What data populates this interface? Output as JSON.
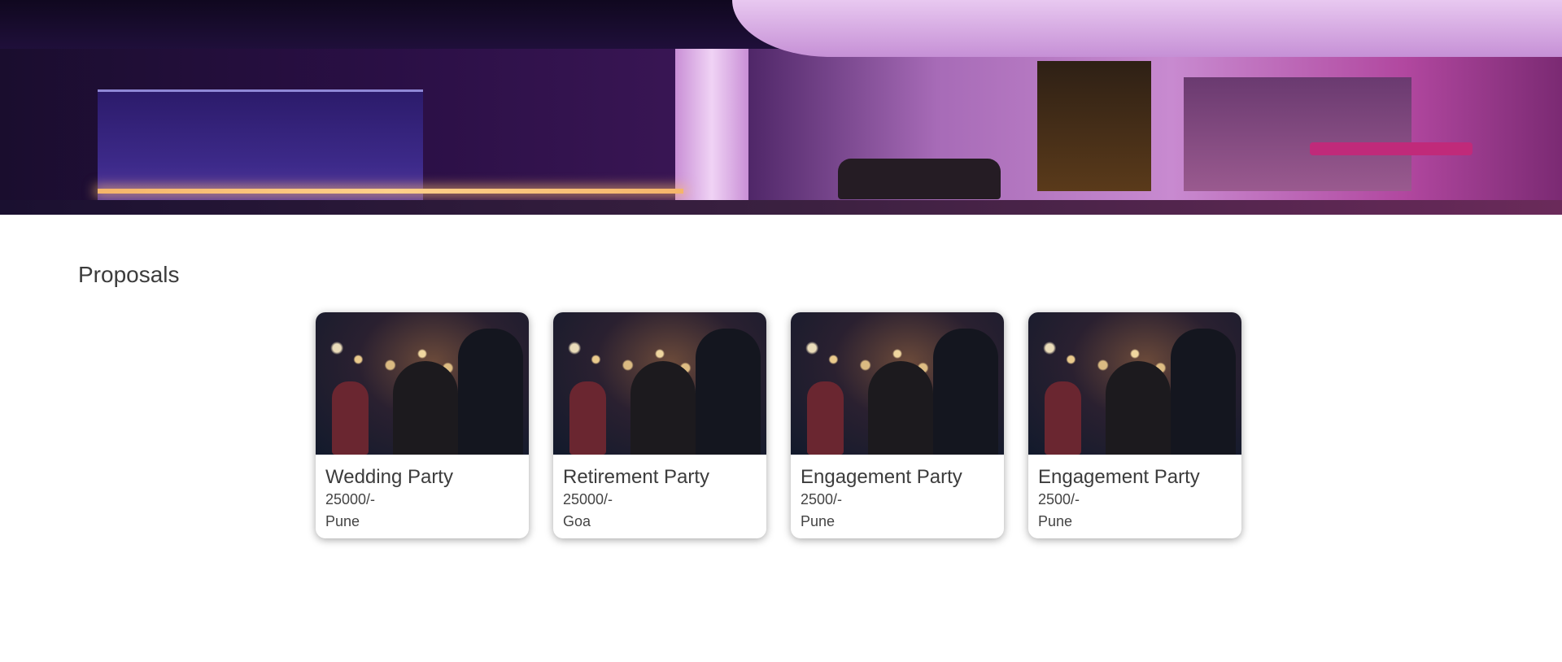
{
  "hero": {
    "alt_icon": "banquet-hall-image"
  },
  "section": {
    "title": "Proposals"
  },
  "proposals": [
    {
      "title": "Wedding Party",
      "price": "25000/-",
      "location": "Pune",
      "image_icon": "party-photo"
    },
    {
      "title": "Retirement Party",
      "price": "25000/-",
      "location": "Goa",
      "image_icon": "party-photo"
    },
    {
      "title": "Engagement Party",
      "price": "2500/-",
      "location": "Pune",
      "image_icon": "party-photo"
    },
    {
      "title": "Engagement Party",
      "price": "2500/-",
      "location": "Pune",
      "image_icon": "party-photo"
    }
  ]
}
